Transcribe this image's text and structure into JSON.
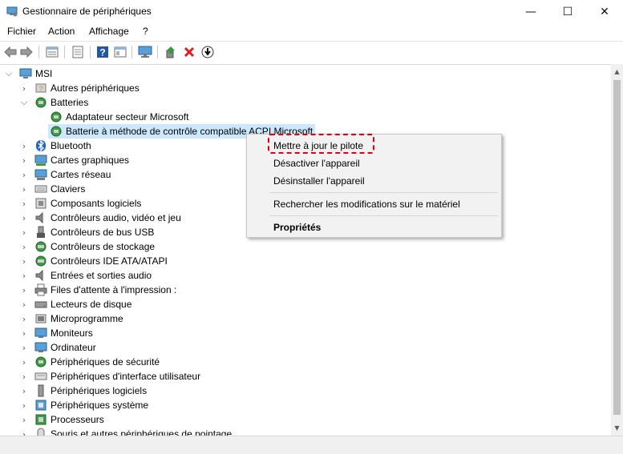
{
  "window": {
    "title": "Gestionnaire de périphériques",
    "controls": {
      "minimize": "—",
      "maximize": "☐",
      "close": "✕"
    }
  },
  "menu": [
    "Fichier",
    "Action",
    "Affichage",
    "?"
  ],
  "toolbar": {
    "icons": [
      "back-arrow-icon",
      "forward-arrow-icon",
      "properties-grid-icon",
      "document-icon",
      "help-icon",
      "view-icon",
      "monitor-icon",
      "update-driver-icon",
      "uninstall-x-icon",
      "download-circle-icon"
    ],
    "accent_colors": {
      "uninstall": "#d81e1e",
      "help": "#2456a6",
      "update": "#2e9e3c"
    }
  },
  "tree": {
    "root": "MSI",
    "batteries": {
      "label": "Batteries",
      "children": [
        "Adaptateur secteur Microsoft",
        "Batterie à méthode de contrôle compatible ACPI Microsoft"
      ]
    },
    "categories": [
      "Autres périphériques",
      "Bluetooth",
      "Cartes graphiques",
      "Cartes réseau",
      "Claviers",
      "Composants logiciels",
      "Contrôleurs audio, vidéo et jeu",
      "Contrôleurs de bus USB",
      "Contrôleurs de stockage",
      "Contrôleurs IDE ATA/ATAPI",
      "Entrées et sorties audio",
      "Files d'attente à l'impression :",
      "Lecteurs de disque",
      "Microprogramme",
      "Moniteurs",
      "Ordinateur",
      "Périphériques de sécurité",
      "Périphériques d'interface utilisateur",
      "Périphériques logiciels",
      "Périphériques système",
      "Processeurs",
      "Souris et autres périphériques de pointage"
    ]
  },
  "context_menu": {
    "items": [
      "Mettre à jour le pilote",
      "Désactiver l'appareil",
      "Désinstaller l'appareil",
      "Rechercher les modifications sur le matériel",
      "Propriétés"
    ],
    "highlight_color": "#e3000f"
  },
  "colors": {
    "selection": "#cce8ff",
    "menu_bg": "#f2f2f2"
  }
}
